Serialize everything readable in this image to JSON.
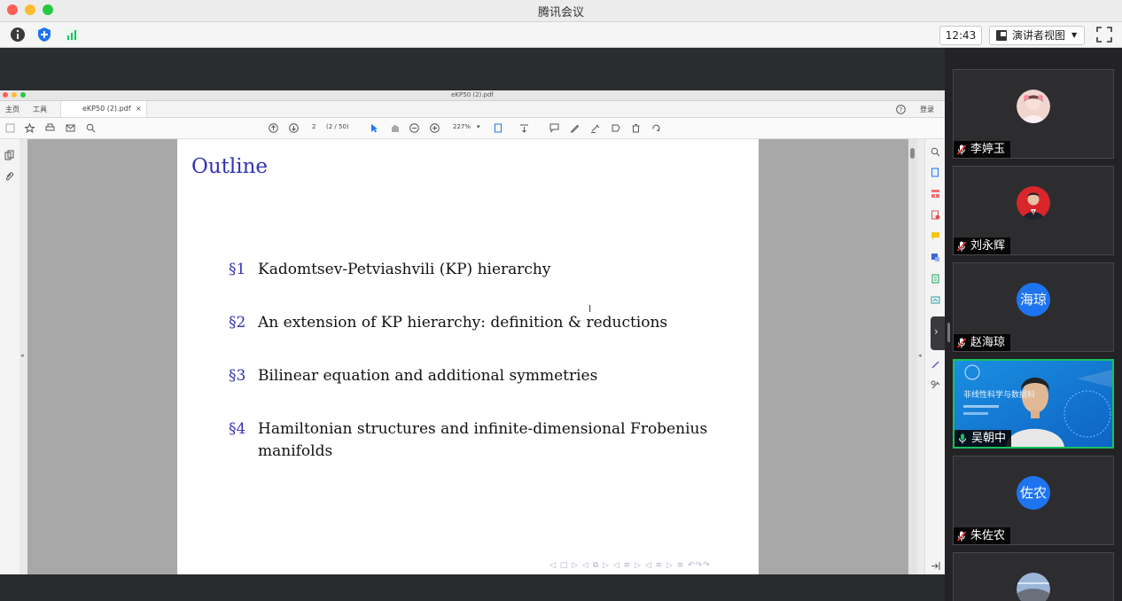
{
  "window": {
    "title": "腾讯会议"
  },
  "meeting_toolbar": {
    "time": "12:43",
    "view_mode": "演讲者视图",
    "icons": [
      "info-icon",
      "shield-icon",
      "signal-icon",
      "fullscreen-icon"
    ]
  },
  "pdf": {
    "title": "eKP50 (2).pdf",
    "tabs": {
      "home": "主页",
      "tools": "工具",
      "doc": "eKP50 (2).pdf",
      "close": "×"
    },
    "login": "登录",
    "toolbar": {
      "page_input": "2",
      "page_count": "(2 / 50)",
      "zoom": "227%"
    }
  },
  "slide": {
    "title": "Outline",
    "sections": [
      {
        "num": "§1",
        "text": "Kadomtsev-Petviashvili (KP) hierarchy"
      },
      {
        "num": "§2",
        "text": "An extension of KP hierarchy: definition & reductions"
      },
      {
        "num": "§3",
        "text": "Bilinear equation and additional symmetries"
      },
      {
        "num": "§4",
        "text": "Hamiltonian structures and infinite-dimensional Frobenius manifolds"
      }
    ],
    "nav_symbols": "◁ □ ▷ ◁ ⧉ ▷ ◁ ≡ ▷ ◁ ≡ ▷    ≡    ↶↷↷"
  },
  "participants": [
    {
      "name": "李婷玉",
      "avatar_text": "",
      "muted": true,
      "active": false
    },
    {
      "name": "刘永辉",
      "avatar_text": "",
      "muted": true,
      "active": false
    },
    {
      "name": "赵海琼",
      "avatar_text": "海琼",
      "muted": true,
      "active": false
    },
    {
      "name": "吴朝中",
      "avatar_text": "",
      "muted": false,
      "active": true,
      "video_banner": "非线性科学与数据科"
    },
    {
      "name": "朱佐农",
      "avatar_text": "佐农",
      "muted": true,
      "active": false
    }
  ],
  "colors": {
    "accent_blue": "#1e74f0",
    "active_green": "#19c15f",
    "slide_blue": "#3333b3"
  }
}
